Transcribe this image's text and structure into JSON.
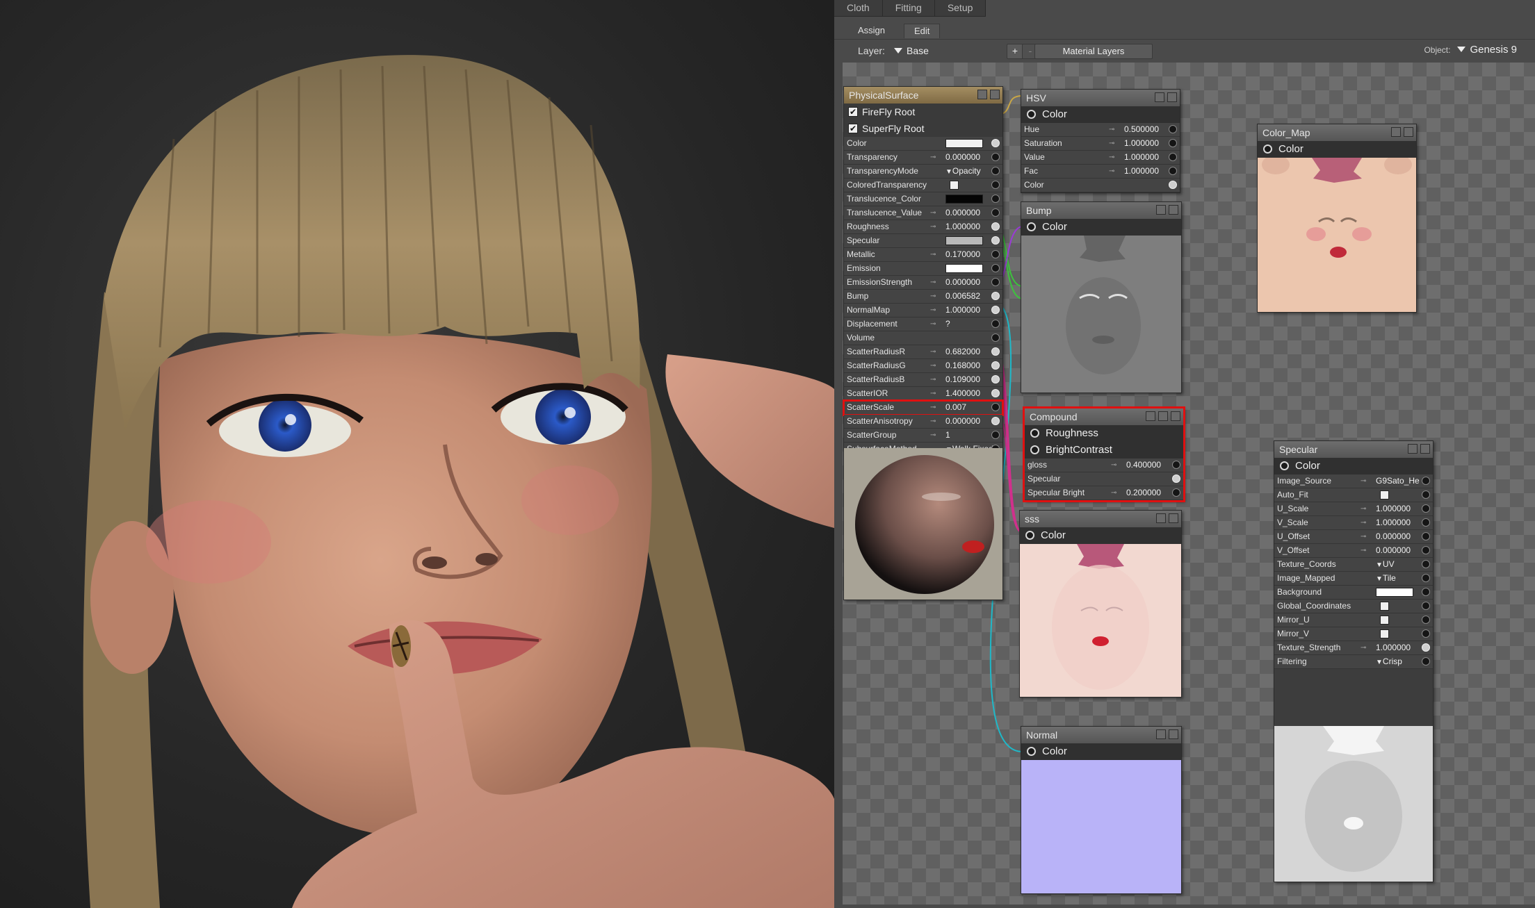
{
  "top_tabs": [
    "Cloth",
    "Fitting",
    "Setup"
  ],
  "sub_tabs": {
    "assign": "Assign",
    "edit": "Edit"
  },
  "object": {
    "label": "Object:",
    "value": "Genesis 9"
  },
  "layer": {
    "label": "Layer:",
    "value": "Base",
    "add": "+",
    "remove": "-",
    "layers_button": "Material Layers"
  },
  "physical_surface": {
    "title": "PhysicalSurface",
    "checks": [
      {
        "label": "FireFly Root",
        "checked": true
      },
      {
        "label": "SuperFly Root",
        "checked": true
      }
    ],
    "params": [
      {
        "name": "Color",
        "value": "",
        "kind": "swatch",
        "swatch": "#f2f2f2",
        "connected": true
      },
      {
        "name": "Transparency",
        "value": "0.000000"
      },
      {
        "name": "TransparencyMode",
        "value": "Opacity",
        "kind": "dropdown"
      },
      {
        "name": "ColoredTransparency",
        "value": "",
        "kind": "checkbox"
      },
      {
        "name": "Translucence_Color",
        "value": "",
        "kind": "swatch",
        "swatch": "#050505"
      },
      {
        "name": "Translucence_Value",
        "value": "0.000000"
      },
      {
        "name": "Roughness",
        "value": "1.000000",
        "connected": true
      },
      {
        "name": "Specular",
        "value": "",
        "kind": "swatch",
        "swatch": "#b8b8b8",
        "connected": true
      },
      {
        "name": "Metallic",
        "value": "0.170000"
      },
      {
        "name": "Emission",
        "value": "",
        "kind": "swatch",
        "swatch": "#ffffff"
      },
      {
        "name": "EmissionStrength",
        "value": "0.000000"
      },
      {
        "name": "Bump",
        "value": "0.006582",
        "connected": true
      },
      {
        "name": "NormalMap",
        "value": "1.000000",
        "connected": true
      },
      {
        "name": "Displacement",
        "value": "?"
      },
      {
        "name": "Volume",
        "value": ""
      },
      {
        "name": "ScatterRadiusR",
        "value": "0.682000",
        "connected": true
      },
      {
        "name": "ScatterRadiusG",
        "value": "0.168000",
        "connected": true
      },
      {
        "name": "ScatterRadiusB",
        "value": "0.109000",
        "connected": true
      },
      {
        "name": "ScatterIOR",
        "value": "1.400000",
        "connected": true
      },
      {
        "name": "ScatterScale",
        "value": "0.007",
        "highlight": true
      },
      {
        "name": "ScatterAnisotropy",
        "value": "0.000000",
        "connected": true
      },
      {
        "name": "ScatterGroup",
        "value": "1"
      },
      {
        "name": "SubsurfaceMethod",
        "value": "Walk Fixed",
        "kind": "dropdown"
      }
    ]
  },
  "hsv": {
    "title": "HSV",
    "output": "Color",
    "params": [
      {
        "name": "Hue",
        "value": "0.500000"
      },
      {
        "name": "Saturation",
        "value": "1.000000"
      },
      {
        "name": "Value",
        "value": "1.000000"
      },
      {
        "name": "Fac",
        "value": "1.000000"
      },
      {
        "name": "Color",
        "value": "",
        "connected": true
      }
    ]
  },
  "color_map": {
    "title": "Color_Map",
    "output": "Color"
  },
  "bump": {
    "title": "Bump",
    "output": "Color"
  },
  "compound": {
    "title": "Compound",
    "outputs": [
      "Roughness",
      "BrightContrast"
    ],
    "params": [
      {
        "name": "gloss",
        "value": "0.400000"
      },
      {
        "name": "Specular",
        "value": "",
        "connected": true
      },
      {
        "name": "Specular Bright",
        "value": "0.200000"
      }
    ]
  },
  "sss": {
    "title": "sss",
    "output": "Color"
  },
  "normal": {
    "title": "Normal",
    "output": "Color"
  },
  "specular": {
    "title": "Specular",
    "output": "Color",
    "params": [
      {
        "name": "Image_Source",
        "value": "G9Sato_He"
      },
      {
        "name": "Auto_Fit",
        "value": "",
        "kind": "checkbox"
      },
      {
        "name": "U_Scale",
        "value": "1.000000"
      },
      {
        "name": "V_Scale",
        "value": "1.000000"
      },
      {
        "name": "U_Offset",
        "value": "0.000000"
      },
      {
        "name": "V_Offset",
        "value": "0.000000"
      },
      {
        "name": "Texture_Coords",
        "value": "UV",
        "kind": "dropdown"
      },
      {
        "name": "Image_Mapped",
        "value": "Tile",
        "kind": "dropdown"
      },
      {
        "name": "Background",
        "value": "",
        "kind": "swatch",
        "swatch": "#ffffff"
      },
      {
        "name": "Global_Coordinates",
        "value": "",
        "kind": "checkbox"
      },
      {
        "name": "Mirror_U",
        "value": "",
        "kind": "checkbox"
      },
      {
        "name": "Mirror_V",
        "value": "",
        "kind": "checkbox"
      },
      {
        "name": "Texture_Strength",
        "value": "1.000000",
        "connected": true
      },
      {
        "name": "Filtering",
        "value": "Crisp",
        "kind": "dropdown"
      }
    ]
  },
  "colors": {
    "wire_gold": "#c9a646",
    "wire_blue": "#2f6fd6",
    "wire_green": "#3cc43c",
    "wire_purple": "#9a3ad6",
    "wire_cyan": "#1fb8c8",
    "wire_magenta": "#d0308c",
    "wire_red": "#d03030",
    "highlight": "#e01010"
  }
}
